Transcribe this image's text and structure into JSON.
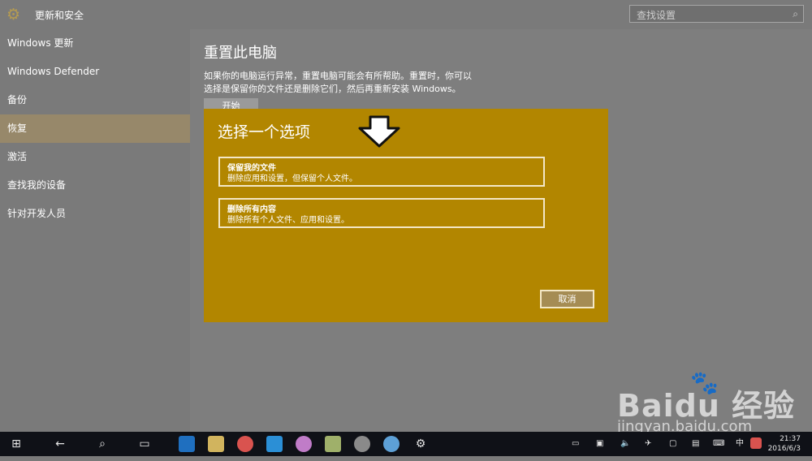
{
  "app": {
    "title": "更新和安全"
  },
  "search": {
    "placeholder": "查找设置"
  },
  "sidebar": {
    "items": [
      {
        "label": "Windows 更新"
      },
      {
        "label": "Windows Defender"
      },
      {
        "label": "备份"
      },
      {
        "label": "恢复"
      },
      {
        "label": "激活"
      },
      {
        "label": "查找我的设备"
      },
      {
        "label": "针对开发人员"
      }
    ]
  },
  "content": {
    "title": "重置此电脑",
    "description": "如果你的电脑运行异常，重置电脑可能会有所帮助。重置时，你可以选择是保留你的文件还是删除它们，然后再重新安装 Windows。",
    "start_label": "开始"
  },
  "dialog": {
    "title": "选择一个选项",
    "options": [
      {
        "title": "保留我的文件",
        "desc": "删除应用和设置，但保留个人文件。"
      },
      {
        "title": "删除所有内容",
        "desc": "删除所有个人文件、应用和设置。"
      }
    ],
    "cancel_label": "取消"
  },
  "watermark": {
    "main": "Bai",
    "mid": "du",
    "brand": "经验",
    "sub": "jingyan.baidu.com"
  },
  "taskbar": {
    "ime": "中",
    "time": "21:37",
    "date": "2016/6/3"
  },
  "colors": {
    "dialog": "#b28600",
    "selected": "#97886a",
    "taskbar": "#0f1117"
  },
  "icons": [
    "gear-icon",
    "search-icon",
    "start-icon",
    "back-icon",
    "search-taskbar-icon",
    "task-view-icon",
    "edge-icon",
    "explorer-icon",
    "chrome-icon",
    "app-icon",
    "settings-icon"
  ]
}
